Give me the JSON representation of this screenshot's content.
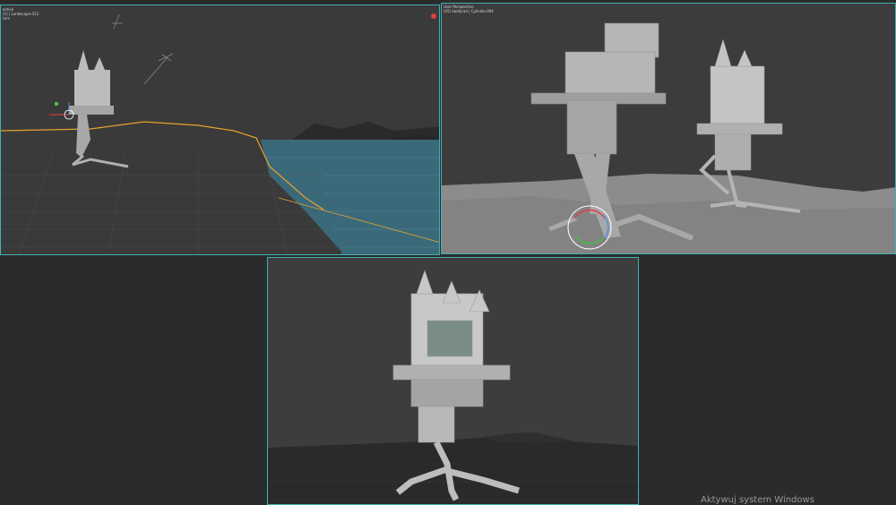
{
  "viewports": {
    "top_left": {
      "hud_lines": [
        "ective",
        "(1) | Landscape.013",
        "ters"
      ],
      "colors": {
        "water": "#3a6a7a",
        "selection_outline": "#e8a030",
        "border": "#3fb0b4"
      }
    },
    "top_right": {
      "hud_lines": [
        "User Perspective",
        "(45) kadlyrad | Cylinder.094"
      ],
      "colors": {
        "ground": "#8a8a8a",
        "model": "#b8b8b8"
      }
    },
    "bottom": {
      "colors": {
        "background": "#3d3d3d",
        "model": "#c8c8c8"
      }
    }
  },
  "watermark": {
    "text": "Aktywuj system Windows"
  },
  "icons": [
    "close-icon",
    "transform-gizmo-icon",
    "rotate-gizmo-icon",
    "light-icon"
  ]
}
